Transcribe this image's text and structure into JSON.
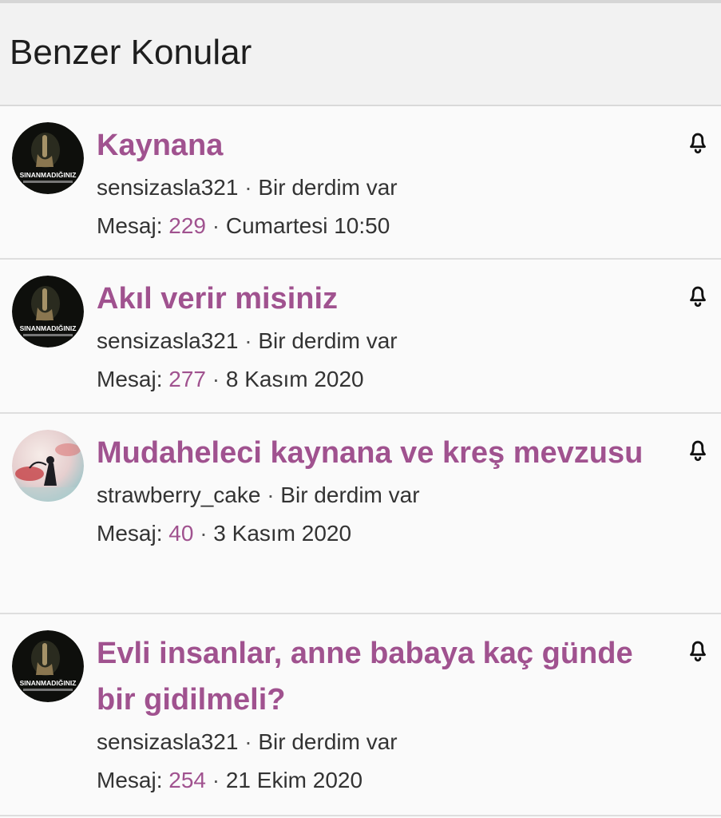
{
  "header": {
    "title": "Benzer Konular"
  },
  "threads": [
    {
      "title": "Kaynana",
      "author": "sensizasla321",
      "forum": "Bir derdim var",
      "messages_label": "Mesaj:",
      "count": "229",
      "date": "Cumartesi 10:50",
      "avatar_text": "SINANMADIĞINIZ"
    },
    {
      "title": "Akıl verir misiniz",
      "author": "sensizasla321",
      "forum": "Bir derdim var",
      "messages_label": "Mesaj:",
      "count": "277",
      "date": "8 Kasım 2020",
      "avatar_text": "SINANMADIĞINIZ"
    },
    {
      "title": "Mudaheleci kaynana ve kreş mevzusu",
      "author": "strawberry_cake",
      "forum": "Bir derdim var",
      "messages_label": "Mesaj:",
      "count": "40",
      "date": "3 Kasım 2020"
    },
    {
      "title": "Evli insanlar, anne babaya kaç günde bir gidilmeli?",
      "author": "sensizasla321",
      "forum": "Bir derdim var",
      "messages_label": "Mesaj:",
      "count": "254",
      "date": "21 Ekim 2020",
      "avatar_text": "SINANMADIĞINIZ"
    }
  ],
  "separator": "·",
  "colors": {
    "accent": "#a0528f"
  },
  "icons": {
    "bell": "bell-icon"
  }
}
